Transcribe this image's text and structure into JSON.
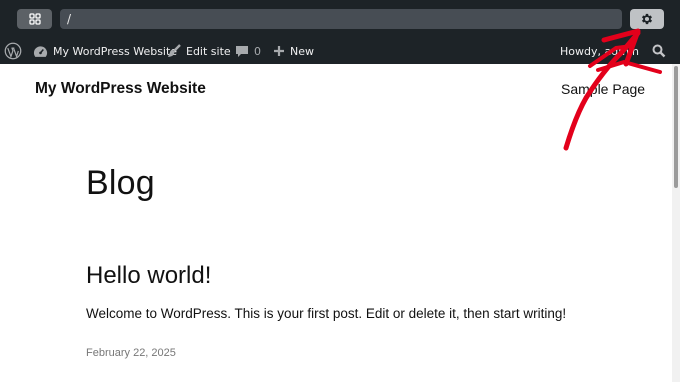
{
  "browser": {
    "address": "/"
  },
  "adminbar": {
    "site_name": "My WordPress Website",
    "edit_site": "Edit site",
    "comments_count": "0",
    "new_label": "New",
    "howdy": "Howdy, admin"
  },
  "site": {
    "title": "My WordPress Website",
    "nav_link": "Sample Page"
  },
  "content": {
    "heading": "Blog",
    "posts": [
      {
        "title": "Hello world!",
        "excerpt": "Welcome to WordPress. This is your first post. Edit or delete it, then start writing!",
        "date": "February 22, 2025"
      }
    ]
  },
  "colors": {
    "adminbar_bg": "#1d2327",
    "annotation_arrow": "#e3001b"
  }
}
